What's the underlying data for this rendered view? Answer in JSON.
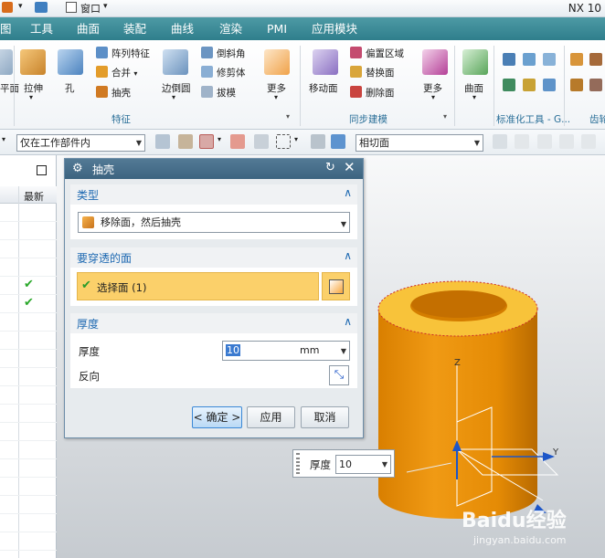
{
  "title_bar": {
    "window_label": "窗口",
    "app_title": "NX 10"
  },
  "menu": [
    "图",
    "工具",
    "曲面",
    "装配",
    "曲线",
    "渲染",
    "PMI",
    "应用模块"
  ],
  "ribbon": {
    "left_partial": [
      "平面"
    ],
    "feature_group": {
      "label": "特征",
      "big_buttons": [
        "拉伸",
        "孔"
      ],
      "small_buttons": [
        "阵列特征",
        "合并",
        "抽壳"
      ],
      "edge_blend": "边倒圆",
      "small_buttons2": [
        "倒斜角",
        "修剪体",
        "拔模"
      ],
      "more": "更多"
    },
    "sync_group": {
      "label": "同步建模",
      "move_face": "移动面",
      "small_buttons": [
        "偏置区域",
        "替换面",
        "删除面"
      ],
      "more": "更多"
    },
    "surface": "曲面",
    "std_group": {
      "label": "标准化工具 - G..."
    },
    "right_partial": "齿轮"
  },
  "toolbar2": {
    "filter_combo": "仅在工作部件内",
    "select_combo": "相切面"
  },
  "left_panel": {
    "header_col": "最新",
    "checks": [
      "✔",
      "✔"
    ]
  },
  "dialog": {
    "title": "抽壳",
    "sections": {
      "type": {
        "header": "类型",
        "value": "移除面，然后抽壳"
      },
      "faces": {
        "header": "要穿透的面",
        "select_label": "选择面 (1)"
      },
      "thickness": {
        "header": "厚度",
        "label": "厚度",
        "value": "10",
        "unit": "mm",
        "reverse_label": "反向"
      }
    },
    "buttons": {
      "ok": "< 确定 >",
      "apply": "应用",
      "cancel": "取消"
    }
  },
  "tooltip": {
    "label": "厚度",
    "value": "10"
  },
  "axes": {
    "z": "Z",
    "y": "Y"
  },
  "watermark": {
    "brand": "Baidu经验",
    "url": "jingyan.baidu.com"
  },
  "colors": {
    "accent": "#2f7e8c",
    "solid": "#e08a00",
    "top_face": "#f8c33a",
    "selection": "#fbd06a"
  }
}
